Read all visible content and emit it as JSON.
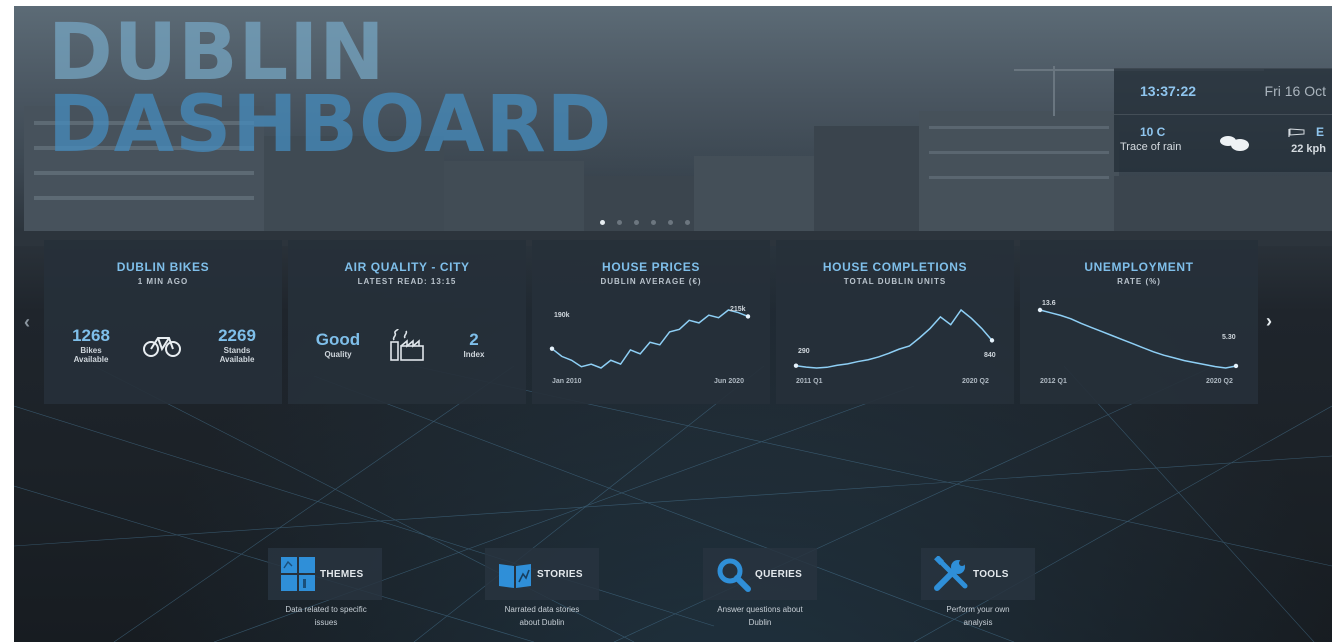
{
  "header": {
    "title_line1": "DUBLIN",
    "title_line2": "DASHBOARD"
  },
  "clock": {
    "time": "13:37:22",
    "date": "Fri 16 Oct",
    "temperature": "10 C",
    "condition": "Trace of rain",
    "wind_direction": "E",
    "wind_speed": "22 kph",
    "weather_icon": "cloud-icon",
    "wind_icon": "windsock-icon"
  },
  "carousel": {
    "dot_count": 6,
    "active_index": 0,
    "prev_label": "‹",
    "next_label": "›"
  },
  "cards": {
    "bikes": {
      "title": "DUBLIN BIKES",
      "subtitle": "1 MIN AGO",
      "bikes_value": "1268",
      "bikes_label_1": "Bikes",
      "bikes_label_2": "Available",
      "stands_value": "2269",
      "stands_label_1": "Stands",
      "stands_label_2": "Available",
      "icon": "bicycle-icon"
    },
    "air": {
      "title": "AIR QUALITY - CITY",
      "subtitle": "LATEST READ: 13:15",
      "quality_value": "Good",
      "quality_label": "Quality",
      "index_value": "2",
      "index_label": "Index",
      "icon": "factory-icon"
    },
    "house_prices": {
      "title": "HOUSE PRICES",
      "subtitle": "DUBLIN AVERAGE (€)",
      "start_label": "190k",
      "end_label": "215k",
      "x_start": "Jan 2010",
      "x_end": "Jun 2020"
    },
    "completions": {
      "title": "HOUSE COMPLETIONS",
      "subtitle": "TOTAL DUBLIN UNITS",
      "start_label": "290",
      "end_label": "840",
      "x_start": "2011 Q1",
      "x_end": "2020 Q2"
    },
    "unemployment": {
      "title": "UNEMPLOYMENT",
      "subtitle": "RATE (%)",
      "start_label": "13.6",
      "end_label": "5.30",
      "x_start": "2012 Q1",
      "x_end": "2020 Q2"
    }
  },
  "chart_data": [
    {
      "type": "line",
      "series": [
        {
          "values": [
            190,
            184,
            181,
            176,
            178,
            175,
            181,
            178,
            189,
            186,
            195,
            193,
            203,
            205,
            212,
            210,
            216,
            214,
            220,
            218,
            215
          ]
        }
      ],
      "x": [
        "Jan 2010",
        "Jun 2020"
      ],
      "title": "HOUSE PRICES"
    },
    {
      "type": "line",
      "series": [
        {
          "values": [
            290,
            260,
            240,
            255,
            300,
            330,
            380,
            420,
            480,
            560,
            650,
            720,
            900,
            1100,
            1350,
            1180,
            1500,
            1320,
            1100,
            840
          ]
        }
      ],
      "x": [
        "2011 Q1",
        "2020 Q2"
      ],
      "title": "HOUSE COMPLETIONS"
    },
    {
      "type": "line",
      "series": [
        {
          "values": [
            13.6,
            13.2,
            12.8,
            12.3,
            11.6,
            11.0,
            10.4,
            9.8,
            9.2,
            8.6,
            8.0,
            7.4,
            6.9,
            6.5,
            6.1,
            5.8,
            5.5,
            5.2,
            5.0,
            5.3
          ]
        }
      ],
      "x": [
        "2012 Q1",
        "2020 Q2"
      ],
      "title": "UNEMPLOYMENT"
    }
  ],
  "buttons": {
    "themes": {
      "label": "THEMES",
      "desc_1": "Data related to specific",
      "desc_2": "issues",
      "icon": "grid-icon"
    },
    "stories": {
      "label": "STORIES",
      "desc_1": "Narrated data stories",
      "desc_2": "about Dublin",
      "icon": "book-icon"
    },
    "queries": {
      "label": "QUERIES",
      "desc_1": "Answer questions about",
      "desc_2": "Dublin",
      "icon": "search-icon"
    },
    "tools": {
      "label": "TOOLS",
      "desc_1": "Perform your own",
      "desc_2": "analysis",
      "icon": "tools-icon"
    }
  },
  "colors": {
    "accent": "#7fbfea",
    "card_bg": "#26303a",
    "line": "#8ecff5"
  }
}
